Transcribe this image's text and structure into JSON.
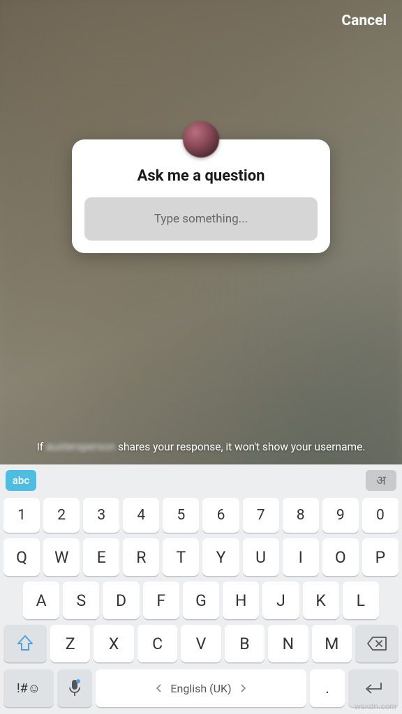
{
  "header": {
    "cancel_label": "Cancel"
  },
  "question_card": {
    "prompt": "Ask me a question",
    "placeholder": "Type something..."
  },
  "disclaimer": {
    "prefix": "If ",
    "blurred_username": "austersperson",
    "suffix": " shares your response, it won't show your username."
  },
  "keyboard": {
    "mode_abc": "abc",
    "mode_hi": "अ",
    "row_numbers": [
      "1",
      "2",
      "3",
      "4",
      "5",
      "6",
      "7",
      "8",
      "9",
      "0"
    ],
    "row_q": [
      "Q",
      "W",
      "E",
      "R",
      "T",
      "Y",
      "U",
      "I",
      "O",
      "P"
    ],
    "row_a": [
      "A",
      "S",
      "D",
      "F",
      "G",
      "H",
      "J",
      "K",
      "L"
    ],
    "row_z": [
      "Z",
      "X",
      "C",
      "V",
      "B",
      "N",
      "M"
    ],
    "sym_label": "!#☺",
    "space_label": "English (UK)",
    "period_label": "."
  },
  "watermark": "wsxdn.com"
}
